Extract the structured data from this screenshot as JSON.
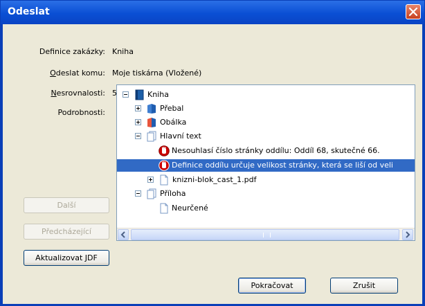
{
  "window": {
    "title": "Odeslat"
  },
  "fields": {
    "definice_label": "Definice zakázky:",
    "definice_value": "Kniha",
    "odeslat_label_first": "O",
    "odeslat_label_rest": "deslat komu:",
    "odeslat_value": "Moje tiskárna (Vložené)",
    "nesrovnalosti_label_first": "N",
    "nesrovnalosti_label_rest": "esrovnalosti:",
    "nesrovnalosti_value": "5",
    "podrobnosti_label": "Podrobnosti:"
  },
  "buttons": {
    "dalsi": "Další",
    "predchazejici": "Předcházející",
    "aktualizovat": "Aktualizovat JDF",
    "pokracovat": "Pokračovat",
    "zrusit": "Zrušit"
  },
  "tree": {
    "items": [
      {
        "label": "Kniha",
        "expander": "minus",
        "icon": "book-icon"
      },
      {
        "label": "Přebal",
        "expander": "plus",
        "icon": "blue-book-icon"
      },
      {
        "label": "Obálka",
        "expander": "plus",
        "icon": "red-book-icon"
      },
      {
        "label": "Hlavní text",
        "expander": "minus",
        "icon": "pages-icon"
      },
      {
        "label": "Nesouhlasí číslo stránky oddílu: Oddíl 68, skutečné 66.",
        "expander": "none",
        "icon": "error-hand-icon"
      },
      {
        "label": "Definice oddílu určuje velikost stránky, která se liší od veli",
        "expander": "none",
        "icon": "error-hand-icon",
        "selected": true
      },
      {
        "label": "knizni-blok_cast_1.pdf",
        "expander": "plus",
        "icon": "document-icon"
      },
      {
        "label": "Příloha",
        "expander": "minus",
        "icon": "pages-icon"
      },
      {
        "label": "Neurčené",
        "expander": "none",
        "icon": "document-icon"
      }
    ]
  },
  "colors": {
    "titlebar": "#0a4fd4",
    "selection": "#316ac5",
    "dialog_bg": "#ece9d8"
  }
}
